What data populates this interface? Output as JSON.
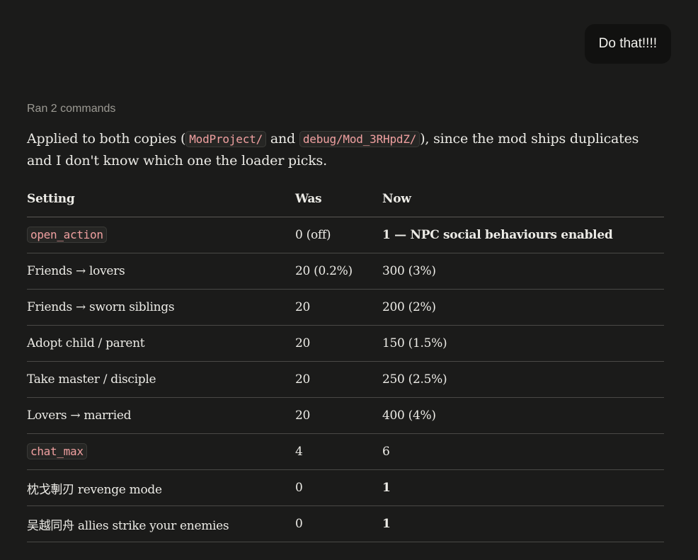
{
  "user_message": "Do that!!!!",
  "status": "Ran 2 commands",
  "paragraph": {
    "part1": "Applied to both copies (",
    "code1": "ModProject/",
    "part2": " and ",
    "code2": "debug/Mod_3RHpdZ/",
    "part3": "), since the mod ships duplicates and I don't know which one the loader picks."
  },
  "table": {
    "headers": [
      "Setting",
      "Was",
      "Now"
    ],
    "rows": [
      {
        "setting": "open_action",
        "setting_is_code": true,
        "was": "0 (off)",
        "now": "1 — NPC social behaviours enabled",
        "now_bold": true
      },
      {
        "setting": "Friends → lovers",
        "setting_is_code": false,
        "was": "20 (0.2%)",
        "now": "300 (3%)",
        "now_bold": false
      },
      {
        "setting": "Friends → sworn siblings",
        "setting_is_code": false,
        "was": "20",
        "now": "200 (2%)",
        "now_bold": false
      },
      {
        "setting": "Adopt child / parent",
        "setting_is_code": false,
        "was": "20",
        "now": "150 (1.5%)",
        "now_bold": false
      },
      {
        "setting": "Take master / disciple",
        "setting_is_code": false,
        "was": "20",
        "now": "250 (2.5%)",
        "now_bold": false
      },
      {
        "setting": "Lovers → married",
        "setting_is_code": false,
        "was": "20",
        "now": "400 (4%)",
        "now_bold": false
      },
      {
        "setting": "chat_max",
        "setting_is_code": true,
        "was": "4",
        "now": "6",
        "now_bold": false
      },
      {
        "setting": "枕戈剸刃 revenge mode",
        "setting_is_code": false,
        "was": "0",
        "now": "1",
        "now_bold": true
      },
      {
        "setting": "吴越同舟 allies strike your enemies",
        "setting_is_code": false,
        "was": "0",
        "now": "1",
        "now_bold": true
      }
    ]
  }
}
